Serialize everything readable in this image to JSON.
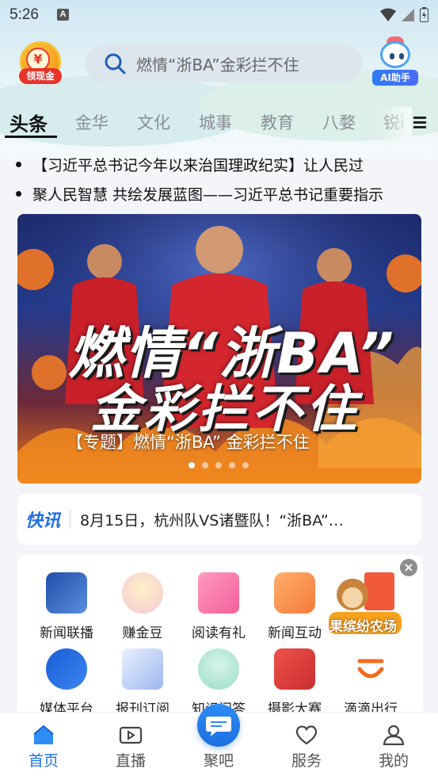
{
  "status_bar": {
    "time": "5:26",
    "notif_glyph": "A"
  },
  "header": {
    "coin_badge_label": "领现金",
    "coin_symbol": "¥",
    "search_placeholder": "燃情“浙BA”金彩拦不住",
    "ai_label": "AI助手"
  },
  "tabs": [
    {
      "label": "头条",
      "active": true
    },
    {
      "label": "金华"
    },
    {
      "label": "文化"
    },
    {
      "label": "城事"
    },
    {
      "label": "教育"
    },
    {
      "label": "八婺"
    },
    {
      "label": "锐i"
    }
  ],
  "headlines": [
    "【习近平总书记今年以来治国理政纪实】让人民过",
    "聚人民智慧 共绘发展蓝图——习近平总书记重要指示"
  ],
  "banner": {
    "title_line1": "燃情“浙BA”",
    "title_line2": "金彩拦不住",
    "caption": "【专题】燃情“浙BA” 金彩拦不住",
    "dot_count": 5,
    "active_dot": 0
  },
  "flash": {
    "label": "快讯",
    "text": "8月15日，杭州队VS诸暨队！“浙BA”…"
  },
  "services": [
    {
      "label": "新闻联播",
      "icon": "news-broadcast-icon"
    },
    {
      "label": "赚金豆",
      "icon": "golden-bean-icon"
    },
    {
      "label": "阅读有礼",
      "icon": "gift-icon"
    },
    {
      "label": "新闻互动",
      "icon": "interaction-icon"
    },
    {
      "label": "媒体平台",
      "icon": "media-platform-icon"
    },
    {
      "label": "报刊订阅",
      "icon": "newspaper-icon"
    },
    {
      "label": "知识问答",
      "icon": "quiz-icon"
    },
    {
      "label": "摄影大赛",
      "icon": "camera-icon"
    },
    {
      "label": "滴滴出行",
      "icon": "didi-icon"
    }
  ],
  "farm_float_label": "果缤纷农场",
  "bottom_nav": [
    {
      "label": "首页",
      "active": true
    },
    {
      "label": "直播"
    },
    {
      "label": "聚吧"
    },
    {
      "label": "服务"
    },
    {
      "label": "我的"
    }
  ],
  "colors": {
    "accent": "#1f72e6",
    "flash": "#1f6fe0",
    "badge": "#e8332a"
  }
}
